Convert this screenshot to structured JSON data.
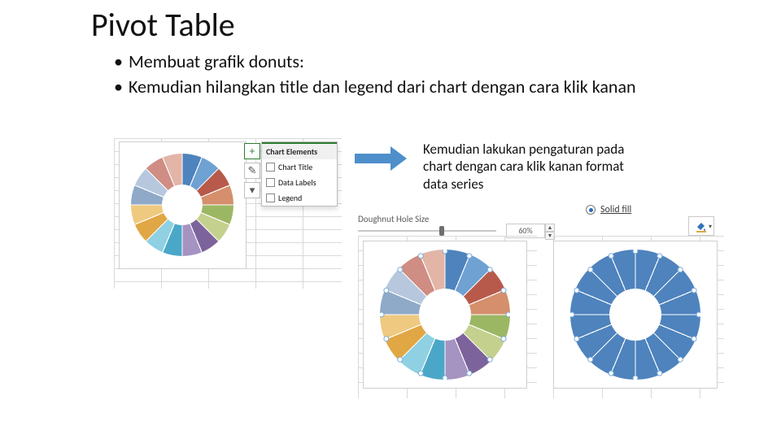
{
  "title": "Pivot Table",
  "bullets": [
    "Membuat grafik donuts:",
    "Kemudian hilangkan title dan legend dari chart dengan cara klik kanan"
  ],
  "note": "Kemudian lakukan pengaturan pada chart dengan cara klik kanan format data series",
  "chart_elements": {
    "heading": "Chart Elements",
    "options": [
      "Chart Title",
      "Data Labels",
      "Legend"
    ]
  },
  "side_buttons": {
    "plus": "+",
    "brush": "✎",
    "filter": "▾"
  },
  "doughnut_hole": {
    "label": "Doughnut Hole Size",
    "value": "60%"
  },
  "fill": {
    "label": "Solid fill"
  },
  "donut_colors_multi": [
    "#4e83bd",
    "#6fa1d2",
    "#b85a4b",
    "#d58f6c",
    "#9cb764",
    "#c4d08d",
    "#7d639b",
    "#a593c2",
    "#4ba7c8",
    "#8fd0e3",
    "#e1a745",
    "#efc97f",
    "#8fa9c8",
    "#b7c8de",
    "#cf8d84",
    "#e3b5a7"
  ],
  "donut_color_solid": "#4e83bd",
  "chart_data": {
    "type": "pie",
    "note": "Doughnut chart with 16 equal slices (≈6.25% each). Left instance shows multicolor categorical palette, right instance shows single solid fill.",
    "series": [
      {
        "name": "multicolor",
        "values": [
          6.25,
          6.25,
          6.25,
          6.25,
          6.25,
          6.25,
          6.25,
          6.25,
          6.25,
          6.25,
          6.25,
          6.25,
          6.25,
          6.25,
          6.25,
          6.25
        ]
      },
      {
        "name": "solid",
        "values": [
          6.25,
          6.25,
          6.25,
          6.25,
          6.25,
          6.25,
          6.25,
          6.25,
          6.25,
          6.25,
          6.25,
          6.25,
          6.25,
          6.25,
          6.25,
          6.25
        ]
      }
    ],
    "doughnut_hole_pct": 60
  }
}
